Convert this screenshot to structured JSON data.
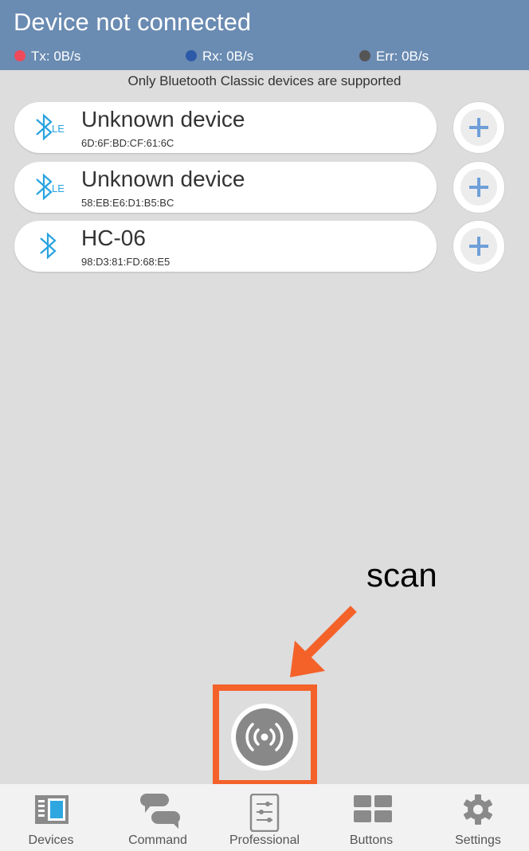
{
  "header": {
    "title": "Device not connected",
    "stats": [
      {
        "label": "Tx: 0B/s",
        "color": "#ef4a5a"
      },
      {
        "label": "Rx: 0B/s",
        "color": "#2c5aa8"
      },
      {
        "label": "Err: 0B/s",
        "color": "#555555"
      }
    ]
  },
  "notice": "Only Bluetooth Classic devices are supported",
  "devices": [
    {
      "name": "Unknown device",
      "mac": "6D:6F:BD:CF:61:6C",
      "icon": "bluetooth-le-icon"
    },
    {
      "name": "Unknown device",
      "mac": "58:EB:E6:D1:B5:BC",
      "icon": "bluetooth-le-icon"
    },
    {
      "name": "HC-06",
      "mac": "98:D3:81:FD:68:E5",
      "icon": "bluetooth-icon"
    }
  ],
  "annotation": {
    "text": "scan",
    "color": "#f4622a"
  },
  "scan_button": {
    "icon": "broadcast-icon"
  },
  "nav": [
    {
      "label": "Devices",
      "icon": "devices-icon",
      "active": true
    },
    {
      "label": "Command",
      "icon": "chat-icon"
    },
    {
      "label": "Professional",
      "icon": "sliders-icon"
    },
    {
      "label": "Buttons",
      "icon": "grid-icon"
    },
    {
      "label": "Settings",
      "icon": "gear-icon"
    }
  ],
  "colors": {
    "header": "#6a8bb2",
    "bluetooth": "#29a3e0",
    "plus": "#6f9fd8"
  }
}
